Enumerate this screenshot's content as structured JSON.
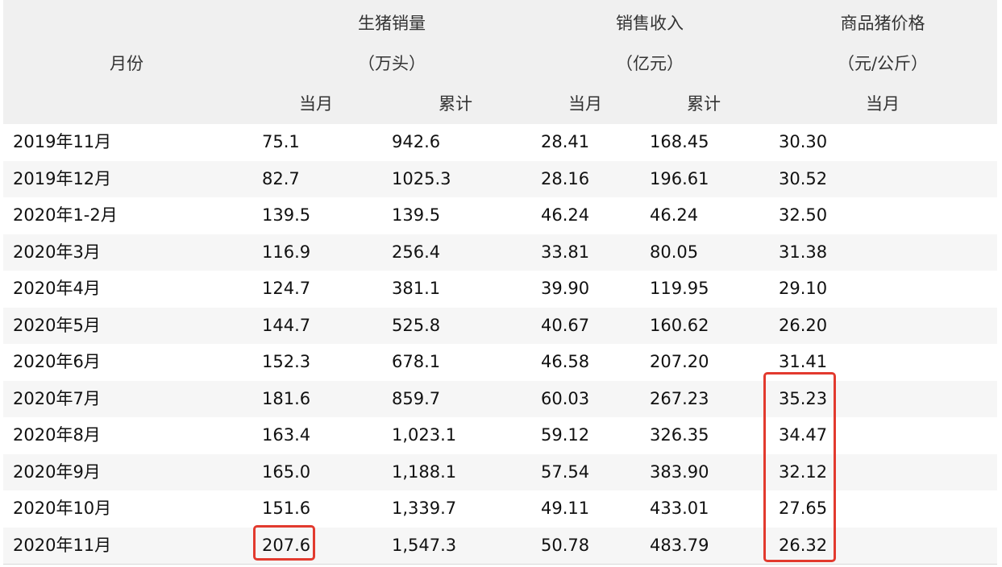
{
  "header": {
    "month": "月份",
    "groups": [
      {
        "title": "生猪销量",
        "unit": "（万头）"
      },
      {
        "title": "销售收入",
        "unit": "（亿元）"
      },
      {
        "title": "商品猪价格",
        "unit": "（元/公斤）"
      }
    ],
    "subheaders": [
      "当月",
      "累计",
      "当月",
      "累计",
      "当月"
    ]
  },
  "rows": [
    [
      "2019年11月",
      "75.1",
      "942.6",
      "28.41",
      "168.45",
      "30.30"
    ],
    [
      "2019年12月",
      "82.7",
      "1025.3",
      "28.16",
      "196.61",
      "30.52"
    ],
    [
      "2020年1-2月",
      "139.5",
      "139.5",
      "46.24",
      "46.24",
      "32.50"
    ],
    [
      "2020年3月",
      "116.9",
      "256.4",
      "33.81",
      "80.05",
      "31.38"
    ],
    [
      "2020年4月",
      "124.7",
      "381.1",
      "39.90",
      "119.95",
      "29.10"
    ],
    [
      "2020年5月",
      "144.7",
      "525.8",
      "40.67",
      "160.62",
      "26.20"
    ],
    [
      "2020年6月",
      "152.3",
      "678.1",
      "46.58",
      "207.20",
      "31.41"
    ],
    [
      "2020年7月",
      "181.6",
      "859.7",
      "60.03",
      "267.23",
      "35.23"
    ],
    [
      "2020年8月",
      "163.4",
      "1,023.1",
      "59.12",
      "326.35",
      "34.47"
    ],
    [
      "2020年9月",
      "165.0",
      "1,188.1",
      "57.54",
      "383.90",
      "32.12"
    ],
    [
      "2020年10月",
      "151.6",
      "1,339.7",
      "49.11",
      "433.01",
      "27.65"
    ],
    [
      "2020年11月",
      "207.6",
      "1,547.3",
      "50.78",
      "483.79",
      "26.32"
    ]
  ],
  "annotation_color": "#e23a2e"
}
